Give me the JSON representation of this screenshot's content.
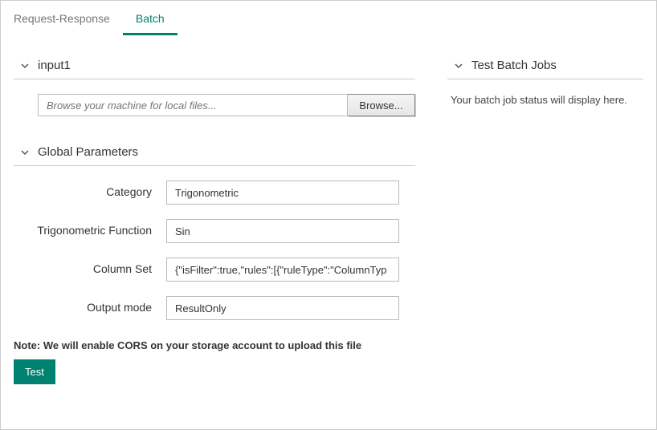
{
  "tabs": {
    "request_response": "Request-Response",
    "batch": "Batch"
  },
  "sections": {
    "input1": "input1",
    "global_params": "Global Parameters",
    "test_batch_jobs": "Test Batch Jobs"
  },
  "file": {
    "placeholder": "Browse your machine for local files...",
    "browse_label": "Browse..."
  },
  "params": {
    "category": {
      "label": "Category",
      "value": "Trigonometric"
    },
    "trig_func": {
      "label": "Trigonometric Function",
      "value": "Sin"
    },
    "column_set": {
      "label": "Column Set",
      "value": "{\"isFilter\":true,\"rules\":[{\"ruleType\":\"ColumnTyp"
    },
    "output_mode": {
      "label": "Output mode",
      "value": "ResultOnly"
    }
  },
  "note": "Note: We will enable CORS on your storage account to upload this file",
  "test_button": "Test",
  "batch_status": "Your batch job status will display here."
}
